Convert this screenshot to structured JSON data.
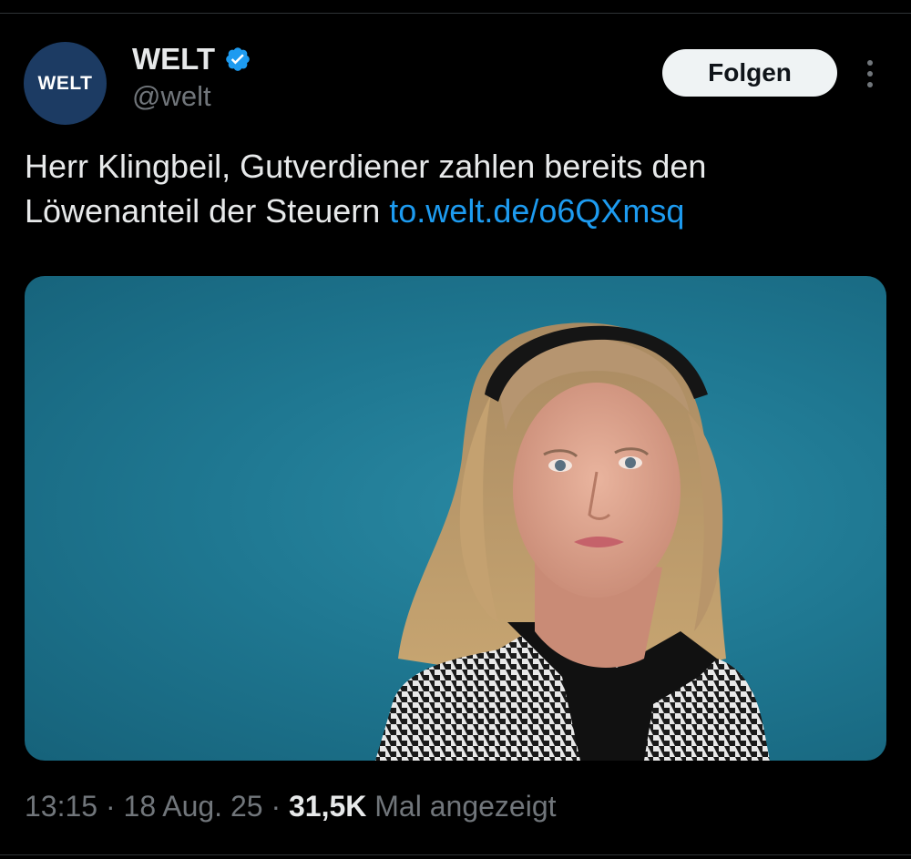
{
  "account": {
    "avatar_text": "WELT",
    "display_name": "WELT",
    "handle": "@welt",
    "verified": true
  },
  "actions": {
    "follow_label": "Folgen",
    "more_icon": "more-vertical-icon"
  },
  "tweet": {
    "text": "Herr Klingbeil, Gutverdiener zahlen bereits den Löwenanteil der Steuern ",
    "link": "to.welt.de/o6QXmsq"
  },
  "meta": {
    "time": "13:15",
    "separator": " · ",
    "date": "18 Aug. 25",
    "views_count": "31,5K",
    "views_label": " Mal angezeigt"
  },
  "colors": {
    "background": "#000000",
    "text": "#e7e9ea",
    "muted": "#71767b",
    "link": "#1d9bf0",
    "verified": "#1d9bf0",
    "avatar": "#1c3b63",
    "media_bg": "#1f7892"
  }
}
